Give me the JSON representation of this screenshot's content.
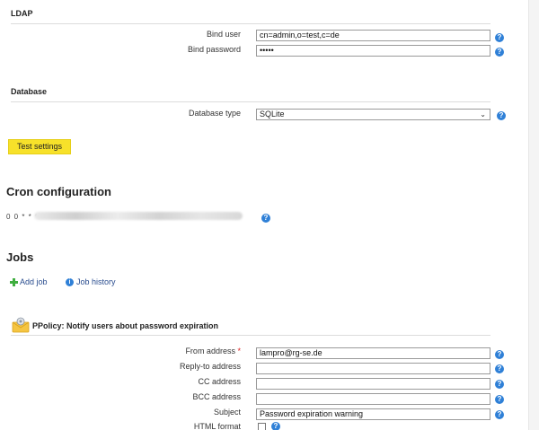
{
  "ldap": {
    "heading": "LDAP",
    "bind_user_label": "Bind user",
    "bind_user_value": "cn=admin,o=test,c=de",
    "bind_password_label": "Bind password",
    "bind_password_value": "•••••"
  },
  "database": {
    "heading": "Database",
    "type_label": "Database type",
    "type_value": "SQLite"
  },
  "test_settings_label": "Test settings",
  "cron": {
    "heading": "Cron configuration",
    "schedule_visible": "0 0 * * *"
  },
  "jobs": {
    "heading": "Jobs",
    "add_job_label": "Add job",
    "job_history_label": "Job history"
  },
  "ppolicy": {
    "title": "PPolicy: Notify users about password expiration",
    "from_label": "From address",
    "required_mark": "*",
    "from_value": "lampro@rg-se.de",
    "reply_to_label": "Reply-to address",
    "reply_to_value": "",
    "cc_label": "CC address",
    "cc_value": "",
    "bcc_label": "BCC address",
    "bcc_value": "",
    "subject_label": "Subject",
    "subject_value": "Password expiration warning",
    "html_format_label": "HTML format"
  },
  "colors": {
    "accent_button": "#f7e12a",
    "help_icon": "#2f80d7",
    "link": "#2a4d8f",
    "add_icon": "#3fae3f"
  },
  "icons": {
    "help": "question-icon",
    "add": "plus-icon",
    "info": "info-icon",
    "ppolicy": "envelope-gear-icon"
  }
}
